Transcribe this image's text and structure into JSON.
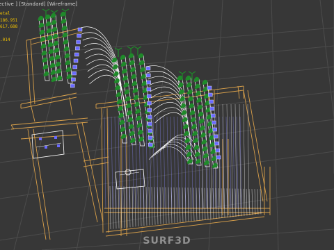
{
  "viewport": {
    "label_parts": [
      "ective",
      "Standard",
      "Wireframe"
    ],
    "stats": [
      "etal",
      "186.951",
      "617.688",
      "",
      ".014"
    ],
    "colors": {
      "background": "#373737",
      "grid": "#4c4c4c",
      "frame": "#d9a04a",
      "wire": "#8c8cff",
      "white_wire": "#ffffff",
      "plants": "#1f8a2a",
      "pots": "#6a6aff",
      "stats_text": "#f2c200"
    }
  },
  "watermark": {
    "text": "SURF3D"
  }
}
